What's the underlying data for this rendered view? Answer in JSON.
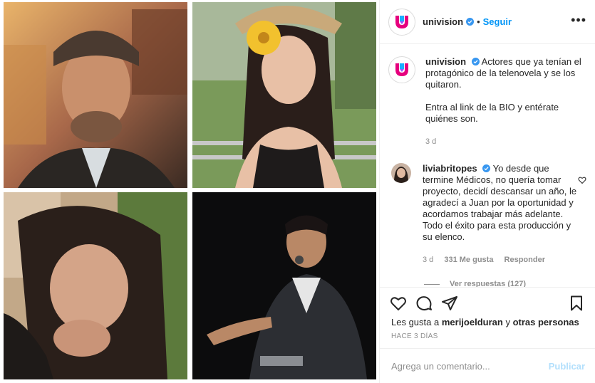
{
  "post": {
    "author": "univision",
    "follow_label": "Seguir",
    "dot": "•",
    "more_label": "•••"
  },
  "caption": {
    "author": "univision",
    "text_1": "Actores que ya tenían el protagónico de la telenovela y se los quitaron.",
    "text_2": "Entra al link de la BIO y entérate quiénes son.",
    "age": "3 d"
  },
  "comment": {
    "author": "liviabritopes",
    "text": "Yo desde que termine Médicos, no quería tomar proyecto, decidí descansar un año, le agradecí a Juan por la oportunidad y acordamos trabajar más adelante. Todo el éxito para esta producción y su elenco.",
    "age": "3 d",
    "likes": "331 Me gusta",
    "reply_label": "Responder",
    "view_replies": "Ver respuestas (127)"
  },
  "likes": {
    "prefix": "Les gusta a",
    "user": "merijoelduran",
    "conj": "y",
    "others": "otras personas"
  },
  "timestamp": "HACE 3 DÍAS",
  "add_comment": {
    "placeholder": "Agrega un comentario...",
    "publish_label": "Publicar"
  },
  "colors": {
    "accent": "#0095f6",
    "publish_disabled": "#b2dffc",
    "muted": "#8e8e8e",
    "text": "#262626"
  }
}
